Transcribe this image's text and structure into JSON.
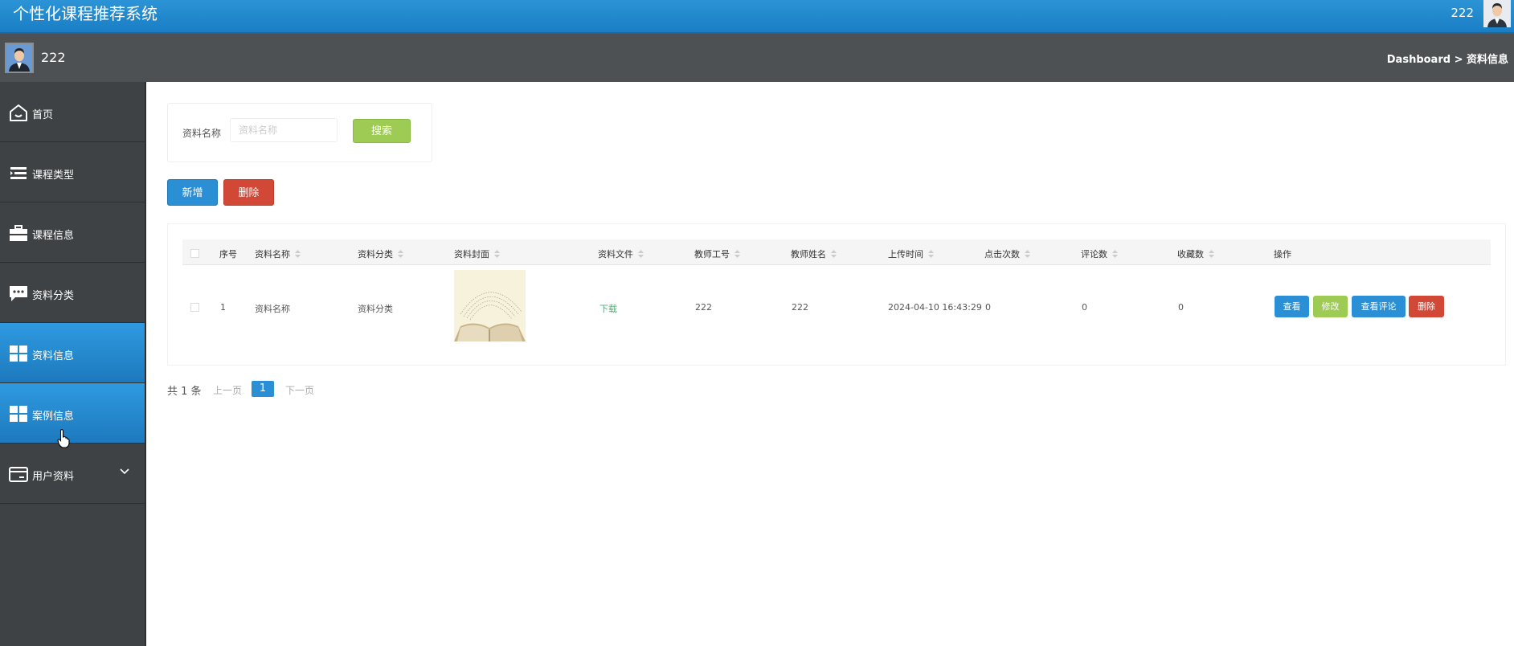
{
  "header": {
    "app_title": "个性化课程推荐系统",
    "user": "222"
  },
  "subbar": {
    "user": "222",
    "breadcrumb": "Dashboard > 资料信息"
  },
  "sidebar": {
    "items": [
      {
        "label": "首页",
        "icon": "home-icon",
        "active": false
      },
      {
        "label": "课程类型",
        "icon": "list-icon",
        "active": false
      },
      {
        "label": "课程信息",
        "icon": "briefcase-icon",
        "active": false
      },
      {
        "label": "资料分类",
        "icon": "chat-icon",
        "active": false
      },
      {
        "label": "资料信息",
        "icon": "grid-icon",
        "active": true
      },
      {
        "label": "案例信息",
        "icon": "grid-icon",
        "active": true
      },
      {
        "label": "用户资料",
        "icon": "card-icon",
        "active": false,
        "expandable": true
      }
    ]
  },
  "search": {
    "label": "资料名称",
    "placeholder": "资料名称",
    "button": "搜索"
  },
  "actions": {
    "add": "新增",
    "delete": "删除"
  },
  "table": {
    "columns": [
      "序号",
      "资料名称",
      "资料分类",
      "资料封面",
      "资料文件",
      "教师工号",
      "教师姓名",
      "上传时间",
      "点击次数",
      "评论数",
      "收藏数",
      "操作"
    ],
    "rows": [
      {
        "index": "1",
        "name": "资料名称",
        "category": "资料分类",
        "file": "下载",
        "teacher_id": "222",
        "teacher_name": "222",
        "upload_time": "2024-04-10 16:43:29",
        "clicks": "0",
        "comments": "0",
        "favorites": "0",
        "ops": {
          "view": "查看",
          "edit": "修改",
          "view_comments": "查看评论",
          "delete": "删除"
        }
      }
    ]
  },
  "pagination": {
    "total": "共 1 条",
    "prev": "上一页",
    "current": "1",
    "next": "下一页"
  },
  "colors": {
    "primary": "#2a8fd4",
    "success": "#9dcb53",
    "danger": "#d14836",
    "sidebar_bg": "#3f4244",
    "subbar_bg": "#4d5153"
  }
}
